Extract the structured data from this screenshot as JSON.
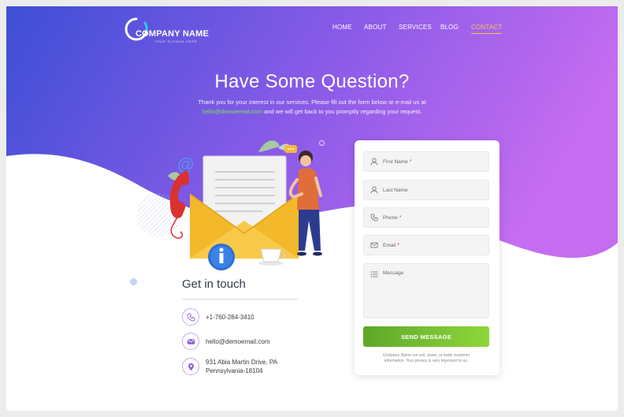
{
  "brand": {
    "name": "COMPANY NAME",
    "tagline": "YOUR SLOGAN HERE"
  },
  "nav": {
    "items": [
      {
        "label": "HOME"
      },
      {
        "label": "ABOUT"
      },
      {
        "label": "SERVICES"
      },
      {
        "label": "BLOG"
      },
      {
        "label": "CONTACT"
      }
    ],
    "active": "CONTACT"
  },
  "hero": {
    "title": "Have Some Question?",
    "sub_line1": "Thank you for your interest in our services. Please fill out the form below or e-mail us at",
    "sub_email": "hello@demoemail.com",
    "sub_line2_rest": " and we will get back to you promptly regarding your request."
  },
  "contact": {
    "title": "Get in touch",
    "phone": "+1-760-284-3410",
    "email": "hello@demoemail.com",
    "address_line1": "931  Abia Martin Drive, PA",
    "address_line2": "Pennsylvania-18104",
    "icons": [
      "phone-icon",
      "mail-icon",
      "location-pin-icon"
    ]
  },
  "form": {
    "fields": [
      {
        "placeholder": "First Name",
        "required": true,
        "icon": "user-icon"
      },
      {
        "placeholder": "Last Name",
        "required": false,
        "icon": "user-icon"
      },
      {
        "placeholder": "Phone",
        "required": true,
        "icon": "phone-icon"
      },
      {
        "placeholder": "Email",
        "required": true,
        "icon": "envelope-icon"
      },
      {
        "placeholder": "Message",
        "required": false,
        "icon": "list-icon"
      }
    ],
    "required_mark": "*",
    "submit_label": "SEND MESSAGE",
    "privacy_line1": "Company Name not sell, share, or trade customer",
    "privacy_line2": "information. Your privacy is very important to us."
  },
  "colors": {
    "gradient_start": "#3d4fd6",
    "gradient_mid": "#8a5be8",
    "gradient_end": "#c56cf0",
    "accent_nav": "#f7c74d",
    "email_link": "#7ee25a",
    "button_start": "#5ea72a",
    "button_end": "#8fd63b",
    "icon_circle": "#c9a6ef"
  }
}
